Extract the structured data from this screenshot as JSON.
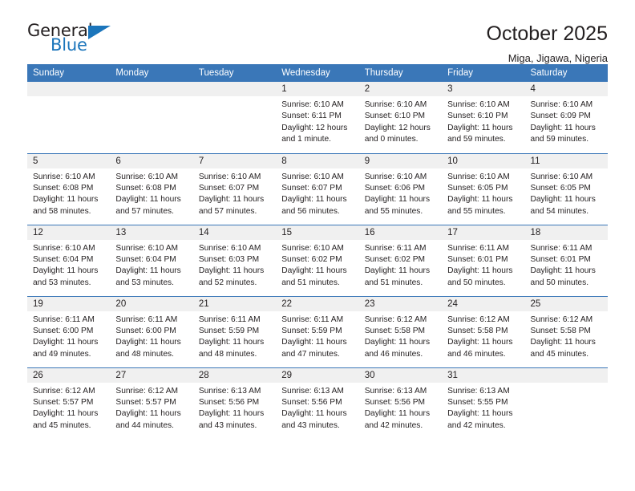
{
  "brand": {
    "name_top": "General",
    "name_bottom": "Blue",
    "triangle_color": "#1b75bb"
  },
  "header": {
    "title": "October 2025",
    "subtitle": "Miga, Jigawa, Nigeria"
  },
  "colors": {
    "header_row": "#3a77b8",
    "daynum_band": "#f0f0f0",
    "text": "#231f20",
    "brand_blue": "#1b75bb"
  },
  "weekday_headers": [
    "Sunday",
    "Monday",
    "Tuesday",
    "Wednesday",
    "Thursday",
    "Friday",
    "Saturday"
  ],
  "weeks": [
    [
      {
        "day": "",
        "sunrise": "",
        "sunset": "",
        "daylight_line1": "",
        "daylight_line2": "",
        "empty": true
      },
      {
        "day": "",
        "sunrise": "",
        "sunset": "",
        "daylight_line1": "",
        "daylight_line2": "",
        "empty": true
      },
      {
        "day": "",
        "sunrise": "",
        "sunset": "",
        "daylight_line1": "",
        "daylight_line2": "",
        "empty": true
      },
      {
        "day": "1",
        "sunrise": "Sunrise: 6:10 AM",
        "sunset": "Sunset: 6:11 PM",
        "daylight_line1": "Daylight: 12 hours",
        "daylight_line2": "and 1 minute."
      },
      {
        "day": "2",
        "sunrise": "Sunrise: 6:10 AM",
        "sunset": "Sunset: 6:10 PM",
        "daylight_line1": "Daylight: 12 hours",
        "daylight_line2": "and 0 minutes."
      },
      {
        "day": "3",
        "sunrise": "Sunrise: 6:10 AM",
        "sunset": "Sunset: 6:10 PM",
        "daylight_line1": "Daylight: 11 hours",
        "daylight_line2": "and 59 minutes."
      },
      {
        "day": "4",
        "sunrise": "Sunrise: 6:10 AM",
        "sunset": "Sunset: 6:09 PM",
        "daylight_line1": "Daylight: 11 hours",
        "daylight_line2": "and 59 minutes."
      }
    ],
    [
      {
        "day": "5",
        "sunrise": "Sunrise: 6:10 AM",
        "sunset": "Sunset: 6:08 PM",
        "daylight_line1": "Daylight: 11 hours",
        "daylight_line2": "and 58 minutes."
      },
      {
        "day": "6",
        "sunrise": "Sunrise: 6:10 AM",
        "sunset": "Sunset: 6:08 PM",
        "daylight_line1": "Daylight: 11 hours",
        "daylight_line2": "and 57 minutes."
      },
      {
        "day": "7",
        "sunrise": "Sunrise: 6:10 AM",
        "sunset": "Sunset: 6:07 PM",
        "daylight_line1": "Daylight: 11 hours",
        "daylight_line2": "and 57 minutes."
      },
      {
        "day": "8",
        "sunrise": "Sunrise: 6:10 AM",
        "sunset": "Sunset: 6:07 PM",
        "daylight_line1": "Daylight: 11 hours",
        "daylight_line2": "and 56 minutes."
      },
      {
        "day": "9",
        "sunrise": "Sunrise: 6:10 AM",
        "sunset": "Sunset: 6:06 PM",
        "daylight_line1": "Daylight: 11 hours",
        "daylight_line2": "and 55 minutes."
      },
      {
        "day": "10",
        "sunrise": "Sunrise: 6:10 AM",
        "sunset": "Sunset: 6:05 PM",
        "daylight_line1": "Daylight: 11 hours",
        "daylight_line2": "and 55 minutes."
      },
      {
        "day": "11",
        "sunrise": "Sunrise: 6:10 AM",
        "sunset": "Sunset: 6:05 PM",
        "daylight_line1": "Daylight: 11 hours",
        "daylight_line2": "and 54 minutes."
      }
    ],
    [
      {
        "day": "12",
        "sunrise": "Sunrise: 6:10 AM",
        "sunset": "Sunset: 6:04 PM",
        "daylight_line1": "Daylight: 11 hours",
        "daylight_line2": "and 53 minutes."
      },
      {
        "day": "13",
        "sunrise": "Sunrise: 6:10 AM",
        "sunset": "Sunset: 6:04 PM",
        "daylight_line1": "Daylight: 11 hours",
        "daylight_line2": "and 53 minutes."
      },
      {
        "day": "14",
        "sunrise": "Sunrise: 6:10 AM",
        "sunset": "Sunset: 6:03 PM",
        "daylight_line1": "Daylight: 11 hours",
        "daylight_line2": "and 52 minutes."
      },
      {
        "day": "15",
        "sunrise": "Sunrise: 6:10 AM",
        "sunset": "Sunset: 6:02 PM",
        "daylight_line1": "Daylight: 11 hours",
        "daylight_line2": "and 51 minutes."
      },
      {
        "day": "16",
        "sunrise": "Sunrise: 6:11 AM",
        "sunset": "Sunset: 6:02 PM",
        "daylight_line1": "Daylight: 11 hours",
        "daylight_line2": "and 51 minutes."
      },
      {
        "day": "17",
        "sunrise": "Sunrise: 6:11 AM",
        "sunset": "Sunset: 6:01 PM",
        "daylight_line1": "Daylight: 11 hours",
        "daylight_line2": "and 50 minutes."
      },
      {
        "day": "18",
        "sunrise": "Sunrise: 6:11 AM",
        "sunset": "Sunset: 6:01 PM",
        "daylight_line1": "Daylight: 11 hours",
        "daylight_line2": "and 50 minutes."
      }
    ],
    [
      {
        "day": "19",
        "sunrise": "Sunrise: 6:11 AM",
        "sunset": "Sunset: 6:00 PM",
        "daylight_line1": "Daylight: 11 hours",
        "daylight_line2": "and 49 minutes."
      },
      {
        "day": "20",
        "sunrise": "Sunrise: 6:11 AM",
        "sunset": "Sunset: 6:00 PM",
        "daylight_line1": "Daylight: 11 hours",
        "daylight_line2": "and 48 minutes."
      },
      {
        "day": "21",
        "sunrise": "Sunrise: 6:11 AM",
        "sunset": "Sunset: 5:59 PM",
        "daylight_line1": "Daylight: 11 hours",
        "daylight_line2": "and 48 minutes."
      },
      {
        "day": "22",
        "sunrise": "Sunrise: 6:11 AM",
        "sunset": "Sunset: 5:59 PM",
        "daylight_line1": "Daylight: 11 hours",
        "daylight_line2": "and 47 minutes."
      },
      {
        "day": "23",
        "sunrise": "Sunrise: 6:12 AM",
        "sunset": "Sunset: 5:58 PM",
        "daylight_line1": "Daylight: 11 hours",
        "daylight_line2": "and 46 minutes."
      },
      {
        "day": "24",
        "sunrise": "Sunrise: 6:12 AM",
        "sunset": "Sunset: 5:58 PM",
        "daylight_line1": "Daylight: 11 hours",
        "daylight_line2": "and 46 minutes."
      },
      {
        "day": "25",
        "sunrise": "Sunrise: 6:12 AM",
        "sunset": "Sunset: 5:58 PM",
        "daylight_line1": "Daylight: 11 hours",
        "daylight_line2": "and 45 minutes."
      }
    ],
    [
      {
        "day": "26",
        "sunrise": "Sunrise: 6:12 AM",
        "sunset": "Sunset: 5:57 PM",
        "daylight_line1": "Daylight: 11 hours",
        "daylight_line2": "and 45 minutes."
      },
      {
        "day": "27",
        "sunrise": "Sunrise: 6:12 AM",
        "sunset": "Sunset: 5:57 PM",
        "daylight_line1": "Daylight: 11 hours",
        "daylight_line2": "and 44 minutes."
      },
      {
        "day": "28",
        "sunrise": "Sunrise: 6:13 AM",
        "sunset": "Sunset: 5:56 PM",
        "daylight_line1": "Daylight: 11 hours",
        "daylight_line2": "and 43 minutes."
      },
      {
        "day": "29",
        "sunrise": "Sunrise: 6:13 AM",
        "sunset": "Sunset: 5:56 PM",
        "daylight_line1": "Daylight: 11 hours",
        "daylight_line2": "and 43 minutes."
      },
      {
        "day": "30",
        "sunrise": "Sunrise: 6:13 AM",
        "sunset": "Sunset: 5:56 PM",
        "daylight_line1": "Daylight: 11 hours",
        "daylight_line2": "and 42 minutes."
      },
      {
        "day": "31",
        "sunrise": "Sunrise: 6:13 AM",
        "sunset": "Sunset: 5:55 PM",
        "daylight_line1": "Daylight: 11 hours",
        "daylight_line2": "and 42 minutes."
      },
      {
        "day": "",
        "sunrise": "",
        "sunset": "",
        "daylight_line1": "",
        "daylight_line2": "",
        "empty": true
      }
    ]
  ]
}
